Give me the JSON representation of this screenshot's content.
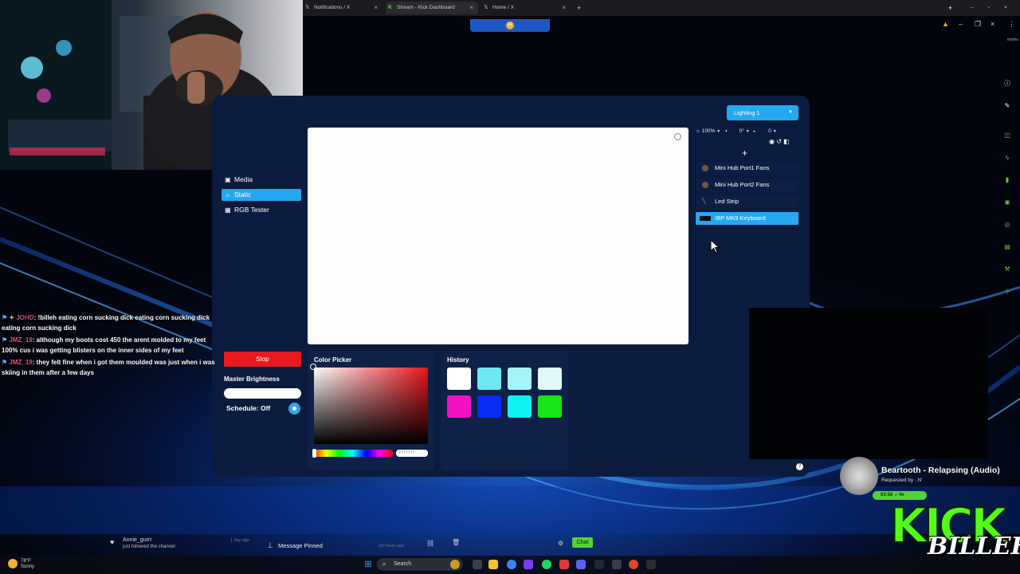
{
  "browser": {
    "tabs": [
      {
        "label": "Notifications / X",
        "active": false
      },
      {
        "label": "Stream - Kick Dashboard",
        "active": true
      },
      {
        "label": "Home / X",
        "active": false
      }
    ],
    "new_tab_label": "+",
    "bookmarks_hint": "marks"
  },
  "app": {
    "sidebar": [
      {
        "label": "Media",
        "icon": "image-icon",
        "active": false
      },
      {
        "label": "Static",
        "icon": "sun-icon",
        "active": true
      },
      {
        "label": "RGB Tester",
        "icon": "grid-icon",
        "active": false
      }
    ],
    "stop_label": "Stop",
    "master_brightness_label": "Master Brightness",
    "brightness_level": 1.0,
    "schedule_label": "Schedule: Off",
    "color_picker_label": "Color Picker",
    "hex_value": "#ffffff",
    "history_label": "History",
    "history_colors": [
      "#ffffff",
      "#6ee9f2",
      "#a4f5f7",
      "#dff9fb",
      "#f012be",
      "#0a2cf5",
      "#11f0f0",
      "#18e418"
    ],
    "lighting_select": "Lighting 1",
    "zoom": "100%",
    "rotation": "0°",
    "offset": "0",
    "add_label": "+",
    "devices": [
      {
        "label": "Mini Hub Port1 Fans",
        "active": false
      },
      {
        "label": "Mini Hub Port2 Fans",
        "active": false
      },
      {
        "label": "Led Strip",
        "active": false
      },
      {
        "label": "IBP MK9 Keyboard",
        "active": true
      }
    ]
  },
  "chat": {
    "messages": [
      {
        "user": "JOHD",
        "text": ": !billeh eating corn sucking dick eating corn sucking dick eating corn sucking dick"
      },
      {
        "user": "JMZ_19",
        "text": ": although my boots cost 450 the arent molded to my feet 100% cus i was getting blisters on the inner sides of my feet"
      },
      {
        "user": "JMZ_19",
        "text": ": they felt fine when i got them moulded was just when i was skiing in them after a few days"
      }
    ]
  },
  "now_playing": {
    "title": "Beartooth - Relapsing (Audio)",
    "requested_by": "Requested by ..N'",
    "time": "03:56 ♫ 4x"
  },
  "activity": {
    "follower_name": "Annie_gurrr",
    "follower_sub": "just followed the channel",
    "follower_time": "1 day ago",
    "pinned_label": "Message Pinned",
    "pinned_time": "18 hours ago",
    "chat_button": "Chat"
  },
  "taskbar": {
    "weather_temp": "78°F",
    "weather_desc": "Sunny",
    "search_placeholder": "Search"
  },
  "overlay": {
    "kick_text": "KICK",
    "signature": "BILLEH"
  }
}
